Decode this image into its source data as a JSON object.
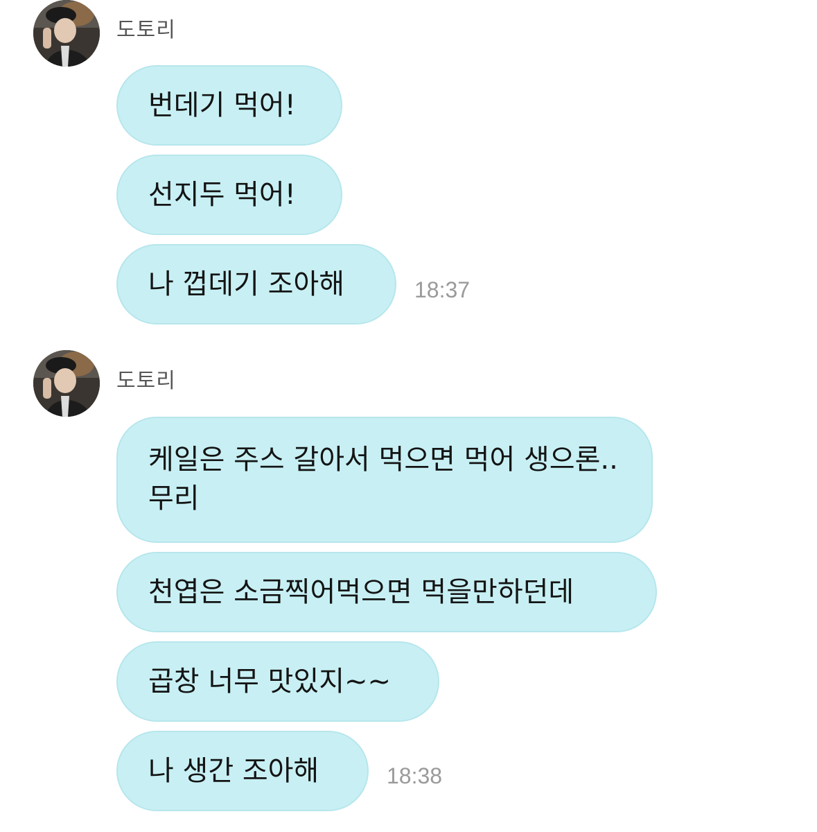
{
  "groups": [
    {
      "sender": "도토리",
      "avatar_icon": "profile-photo",
      "messages": [
        "번데기 먹어!",
        "선지두 먹어!",
        "나 껍데기 조아해"
      ],
      "time": "18:37"
    },
    {
      "sender": "도토리",
      "avatar_icon": "profile-photo",
      "messages": [
        "케일은 주스 갈아서 먹으면 먹어 생으론..무리",
        "천엽은 소금찍어먹으면 먹을만하던데",
        "곱창 너무 맛있지~~",
        "나 생간 조아해"
      ],
      "time": "18:38"
    }
  ],
  "colors": {
    "bubble": "#c8f0f4",
    "bubble_border": "#b6e6ec",
    "time_text": "#9a9a9a",
    "sender_text": "#555555"
  }
}
